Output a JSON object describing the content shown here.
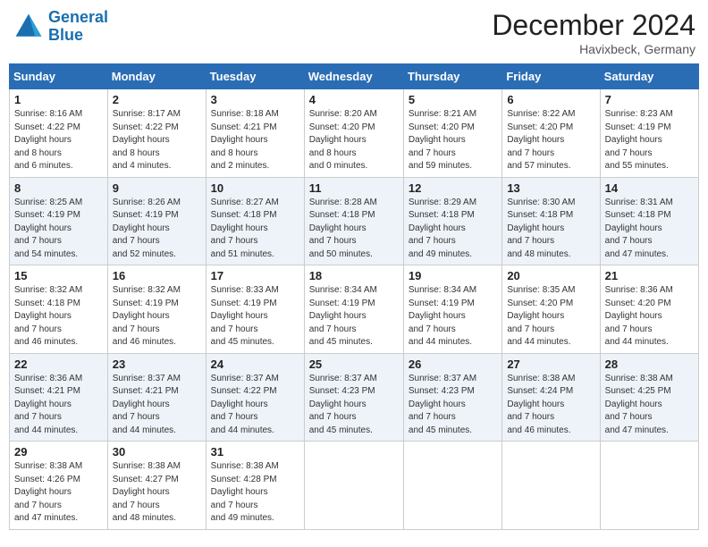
{
  "header": {
    "logo_line1": "General",
    "logo_line2": "Blue",
    "month": "December 2024",
    "location": "Havixbeck, Germany"
  },
  "days_of_week": [
    "Sunday",
    "Monday",
    "Tuesday",
    "Wednesday",
    "Thursday",
    "Friday",
    "Saturday"
  ],
  "weeks": [
    [
      {
        "day": "1",
        "sunrise": "8:16 AM",
        "sunset": "4:22 PM",
        "daylight": "8 hours and 6 minutes."
      },
      {
        "day": "2",
        "sunrise": "8:17 AM",
        "sunset": "4:22 PM",
        "daylight": "8 hours and 4 minutes."
      },
      {
        "day": "3",
        "sunrise": "8:18 AM",
        "sunset": "4:21 PM",
        "daylight": "8 hours and 2 minutes."
      },
      {
        "day": "4",
        "sunrise": "8:20 AM",
        "sunset": "4:20 PM",
        "daylight": "8 hours and 0 minutes."
      },
      {
        "day": "5",
        "sunrise": "8:21 AM",
        "sunset": "4:20 PM",
        "daylight": "7 hours and 59 minutes."
      },
      {
        "day": "6",
        "sunrise": "8:22 AM",
        "sunset": "4:20 PM",
        "daylight": "7 hours and 57 minutes."
      },
      {
        "day": "7",
        "sunrise": "8:23 AM",
        "sunset": "4:19 PM",
        "daylight": "7 hours and 55 minutes."
      }
    ],
    [
      {
        "day": "8",
        "sunrise": "8:25 AM",
        "sunset": "4:19 PM",
        "daylight": "7 hours and 54 minutes."
      },
      {
        "day": "9",
        "sunrise": "8:26 AM",
        "sunset": "4:19 PM",
        "daylight": "7 hours and 52 minutes."
      },
      {
        "day": "10",
        "sunrise": "8:27 AM",
        "sunset": "4:18 PM",
        "daylight": "7 hours and 51 minutes."
      },
      {
        "day": "11",
        "sunrise": "8:28 AM",
        "sunset": "4:18 PM",
        "daylight": "7 hours and 50 minutes."
      },
      {
        "day": "12",
        "sunrise": "8:29 AM",
        "sunset": "4:18 PM",
        "daylight": "7 hours and 49 minutes."
      },
      {
        "day": "13",
        "sunrise": "8:30 AM",
        "sunset": "4:18 PM",
        "daylight": "7 hours and 48 minutes."
      },
      {
        "day": "14",
        "sunrise": "8:31 AM",
        "sunset": "4:18 PM",
        "daylight": "7 hours and 47 minutes."
      }
    ],
    [
      {
        "day": "15",
        "sunrise": "8:32 AM",
        "sunset": "4:18 PM",
        "daylight": "7 hours and 46 minutes."
      },
      {
        "day": "16",
        "sunrise": "8:32 AM",
        "sunset": "4:19 PM",
        "daylight": "7 hours and 46 minutes."
      },
      {
        "day": "17",
        "sunrise": "8:33 AM",
        "sunset": "4:19 PM",
        "daylight": "7 hours and 45 minutes."
      },
      {
        "day": "18",
        "sunrise": "8:34 AM",
        "sunset": "4:19 PM",
        "daylight": "7 hours and 45 minutes."
      },
      {
        "day": "19",
        "sunrise": "8:34 AM",
        "sunset": "4:19 PM",
        "daylight": "7 hours and 44 minutes."
      },
      {
        "day": "20",
        "sunrise": "8:35 AM",
        "sunset": "4:20 PM",
        "daylight": "7 hours and 44 minutes."
      },
      {
        "day": "21",
        "sunrise": "8:36 AM",
        "sunset": "4:20 PM",
        "daylight": "7 hours and 44 minutes."
      }
    ],
    [
      {
        "day": "22",
        "sunrise": "8:36 AM",
        "sunset": "4:21 PM",
        "daylight": "7 hours and 44 minutes."
      },
      {
        "day": "23",
        "sunrise": "8:37 AM",
        "sunset": "4:21 PM",
        "daylight": "7 hours and 44 minutes."
      },
      {
        "day": "24",
        "sunrise": "8:37 AM",
        "sunset": "4:22 PM",
        "daylight": "7 hours and 44 minutes."
      },
      {
        "day": "25",
        "sunrise": "8:37 AM",
        "sunset": "4:23 PM",
        "daylight": "7 hours and 45 minutes."
      },
      {
        "day": "26",
        "sunrise": "8:37 AM",
        "sunset": "4:23 PM",
        "daylight": "7 hours and 45 minutes."
      },
      {
        "day": "27",
        "sunrise": "8:38 AM",
        "sunset": "4:24 PM",
        "daylight": "7 hours and 46 minutes."
      },
      {
        "day": "28",
        "sunrise": "8:38 AM",
        "sunset": "4:25 PM",
        "daylight": "7 hours and 47 minutes."
      }
    ],
    [
      {
        "day": "29",
        "sunrise": "8:38 AM",
        "sunset": "4:26 PM",
        "daylight": "7 hours and 47 minutes."
      },
      {
        "day": "30",
        "sunrise": "8:38 AM",
        "sunset": "4:27 PM",
        "daylight": "7 hours and 48 minutes."
      },
      {
        "day": "31",
        "sunrise": "8:38 AM",
        "sunset": "4:28 PM",
        "daylight": "7 hours and 49 minutes."
      },
      null,
      null,
      null,
      null
    ]
  ]
}
